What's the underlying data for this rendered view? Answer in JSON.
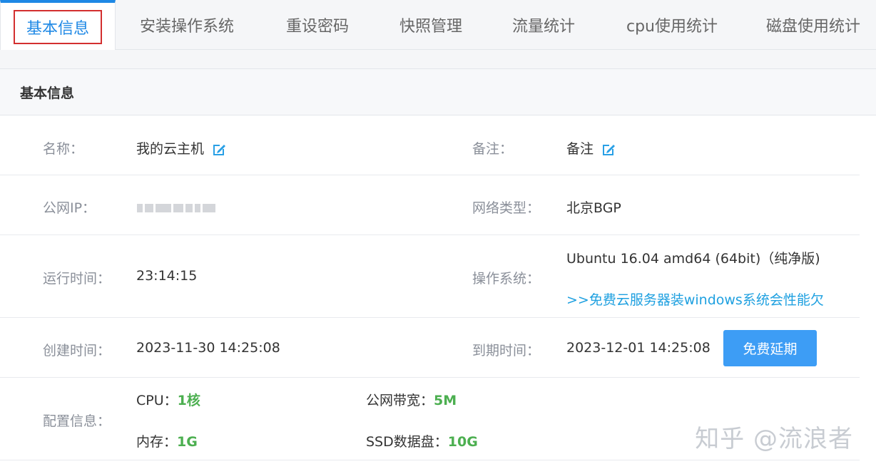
{
  "tabs": [
    {
      "label": "基本信息"
    },
    {
      "label": "安装操作系统"
    },
    {
      "label": "重设密码"
    },
    {
      "label": "快照管理"
    },
    {
      "label": "流量统计"
    },
    {
      "label": "cpu使用统计"
    },
    {
      "label": "磁盘使用统计"
    }
  ],
  "panel": {
    "title": "基本信息"
  },
  "rows": {
    "name": {
      "label": "名称：",
      "value": "我的云主机"
    },
    "remark": {
      "label": "备注：",
      "value": "备注"
    },
    "ip": {
      "label": "公网IP："
    },
    "network": {
      "label": "网络类型：",
      "value": "北京BGP"
    },
    "uptime": {
      "label": "运行时间：",
      "value": "23:14:15"
    },
    "os": {
      "label": "操作系统：",
      "value": "Ubuntu 16.04 amd64 (64bit)（纯净版)",
      "link": ">>免费云服务器装windows系统会性能欠"
    },
    "created": {
      "label": "创建时间：",
      "value": "2023-11-30 14:25:08"
    },
    "expire": {
      "label": "到期时间：",
      "value": "2023-12-01 14:25:08",
      "button": "免费延期"
    },
    "config": {
      "label": "配置信息：",
      "cpu_label": "CPU：",
      "cpu_value": "1核",
      "bw_label": "公网带宽：",
      "bw_value": "5M",
      "mem_label": "内存：",
      "mem_value": "1G",
      "disk_label": "SSD数据盘：",
      "disk_value": "10G"
    }
  },
  "watermark": "知乎 @流浪者",
  "colors": {
    "accent": "#1e88e5",
    "button": "#3d9df5",
    "highlight": "#4caf50",
    "label": "#8a8f99"
  }
}
